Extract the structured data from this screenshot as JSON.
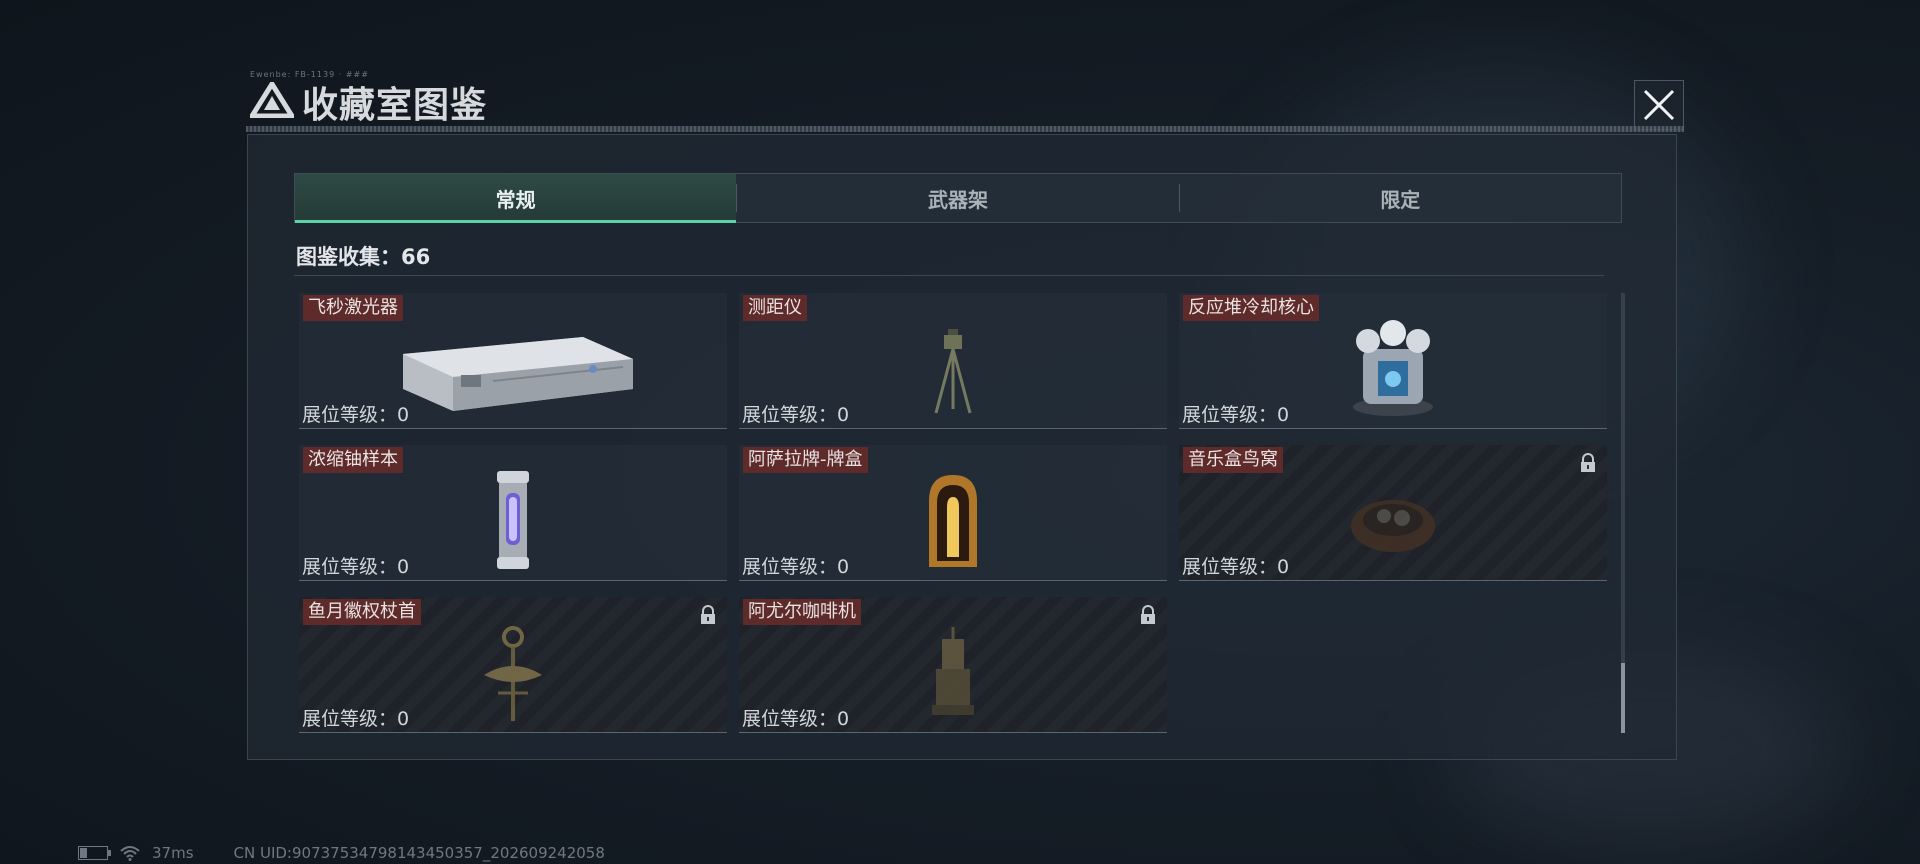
{
  "header": {
    "title": "收藏室图鉴",
    "tiny_label": "Ewenbe: FB-1139 · ###",
    "close_icon": "close-icon"
  },
  "tabs": [
    {
      "label": "常规",
      "active": true
    },
    {
      "label": "武器架",
      "active": false
    },
    {
      "label": "限定",
      "active": false
    }
  ],
  "collection": {
    "label": "图鉴收集：66"
  },
  "items": [
    {
      "name": "飞秒激光器",
      "level": "展位等级：0",
      "locked": false,
      "icon": "laser-device-icon"
    },
    {
      "name": "测距仪",
      "level": "展位等级：0",
      "locked": false,
      "icon": "rangefinder-tripod-icon"
    },
    {
      "name": "反应堆冷却核心",
      "level": "展位等级：0",
      "locked": false,
      "icon": "reactor-core-icon"
    },
    {
      "name": "浓缩铀样本",
      "level": "展位等级：0",
      "locked": false,
      "icon": "uranium-canister-icon"
    },
    {
      "name": "阿萨拉牌-牌盒",
      "level": "展位等级：0",
      "locked": false,
      "icon": "card-box-icon"
    },
    {
      "name": "音乐盒鸟窝",
      "level": "展位等级：0",
      "locked": true,
      "icon": "bird-nest-icon"
    },
    {
      "name": "鱼月徽权杖首",
      "level": "展位等级：0",
      "locked": true,
      "icon": "scepter-head-icon"
    },
    {
      "name": "阿尤尔咖啡机",
      "level": "展位等级：0",
      "locked": true,
      "icon": "coffee-machine-icon"
    }
  ],
  "status_bar": {
    "ping": "37ms",
    "uid": "CN UID:90737534798143450357_202609242058"
  },
  "colors": {
    "accent": "#5fd1a6",
    "name_tag": "#5e2a2a",
    "panel": "#202933"
  }
}
